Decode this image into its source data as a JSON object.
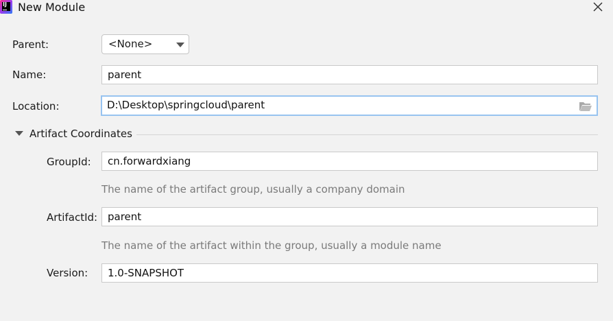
{
  "window": {
    "title": "New Module"
  },
  "form": {
    "parent": {
      "label": "Parent:",
      "selected": "<None>"
    },
    "name": {
      "label": "Name:",
      "value": "parent"
    },
    "location": {
      "label": "Location:",
      "value": "D:\\Desktop\\springcloud\\parent"
    },
    "artifact_section": {
      "title": "Artifact Coordinates",
      "expanded": true
    },
    "group_id": {
      "label": "GroupId:",
      "value": "cn.forwardxiang",
      "hint": "The name of the artifact group, usually a company domain"
    },
    "artifact_id": {
      "label": "ArtifactId:",
      "value": "parent",
      "hint": "The name of the artifact within the group, usually a module name"
    },
    "version": {
      "label": "Version:",
      "value": "1.0-SNAPSHOT"
    }
  },
  "icons": {
    "app": "intellij-idea-icon",
    "close": "close-icon",
    "browse": "folder-icon",
    "toggle": "chevron-down-icon",
    "dropdown": "chevron-down-icon"
  },
  "colors": {
    "background": "#f2f2f2",
    "field_background": "#ffffff",
    "field_border": "#c9c9c9",
    "focus_border": "#97c3f0",
    "hint_text": "#7a7a7a"
  }
}
